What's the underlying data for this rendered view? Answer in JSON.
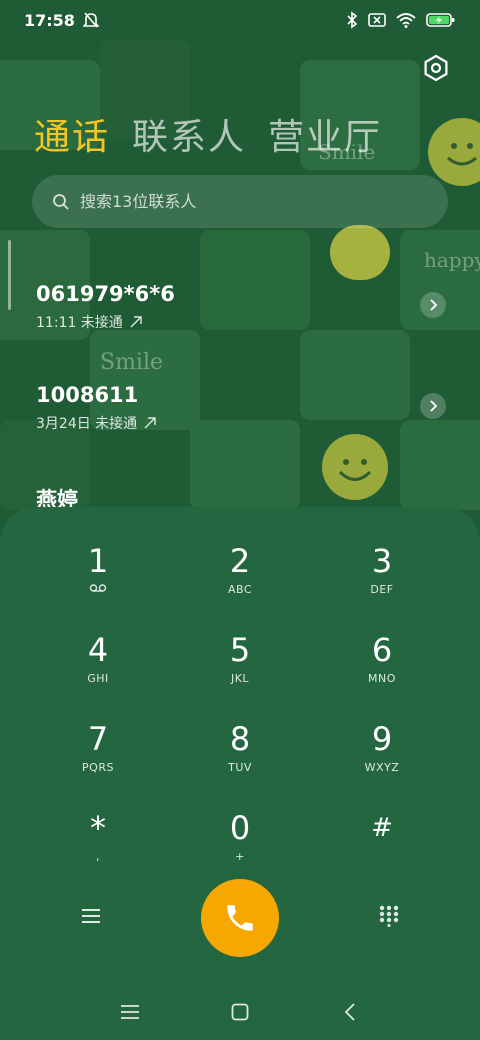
{
  "status_bar": {
    "time": "17:58",
    "icons": [
      "mute-notification-icon",
      "bluetooth-icon",
      "sim-off-icon",
      "wifi-icon",
      "battery-charging-icon"
    ]
  },
  "tabs": [
    {
      "label": "通话",
      "active": true
    },
    {
      "label": "联系人",
      "active": false
    },
    {
      "label": "营业厅",
      "active": false
    }
  ],
  "search": {
    "placeholder": "搜索13位联系人"
  },
  "calls": [
    {
      "number": "061979*6*6",
      "meta": "11:11 未接通"
    },
    {
      "number": "1008611",
      "meta": "3月24日 未接通"
    },
    {
      "number": "燕婷",
      "meta": ""
    }
  ],
  "dialpad": {
    "keys": [
      {
        "digit": "1",
        "letters": "voicemail-icon"
      },
      {
        "digit": "2",
        "letters": "ABC"
      },
      {
        "digit": "3",
        "letters": "DEF"
      },
      {
        "digit": "4",
        "letters": "GHI"
      },
      {
        "digit": "5",
        "letters": "JKL"
      },
      {
        "digit": "6",
        "letters": "MNO"
      },
      {
        "digit": "7",
        "letters": "PQRS"
      },
      {
        "digit": "8",
        "letters": "TUV"
      },
      {
        "digit": "9",
        "letters": "WXYZ"
      },
      {
        "digit": "*",
        "letters": ","
      },
      {
        "digit": "0",
        "letters": "+"
      },
      {
        "digit": "#",
        "letters": ""
      }
    ]
  },
  "colors": {
    "accent": "#f3c623",
    "call_button": "#f7a800",
    "background": "#1f5c36",
    "dialpad_bg": "#236640"
  },
  "wallpaper_text": [
    "Smile",
    "happy",
    "Smile"
  ]
}
